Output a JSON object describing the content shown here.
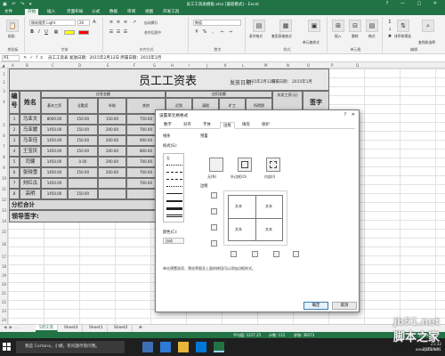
{
  "titlebar": {
    "qat": "▣ ↶ ↷ ▾",
    "title": "员工工资表模板.xlsx [兼容模式] - Excel",
    "window_buttons": "? — □ ✕"
  },
  "ribbon_tabs": [
    "文件",
    "开始",
    "插入",
    "页面布局",
    "公式",
    "数据",
    "审阅",
    "视图",
    "开发工具"
  ],
  "ribbon": {
    "paste": "粘贴",
    "clipboard": "剪贴板",
    "font_name": "微软雅黑 Light",
    "font_size": "26",
    "font": "字体",
    "alignment": "对齐方式",
    "wrap": "自动换行",
    "merge": "合并后居中",
    "number_format": "数值",
    "number": "数字",
    "conditional": "条件格式",
    "table_format": "套用表格格式",
    "cell_styles": "单元格样式",
    "styles": "样式",
    "insert": "插入",
    "delete": "删除",
    "format": "格式",
    "cells": "单元格",
    "sort_filter": "排序和筛选",
    "find_select": "查找和选择",
    "editing": "编辑"
  },
  "formula_bar": {
    "name_box": "A1",
    "content": "员工工资表   发放日期：2015年2月12日  所属日期：2015年1月"
  },
  "columns": [
    "A",
    "B",
    "C",
    "D",
    "E",
    "F",
    "G",
    "H",
    "I",
    "J",
    "K",
    "L",
    "M",
    "N",
    "O",
    "P",
    "Q"
  ],
  "rows": [
    "1",
    "2",
    "3",
    "4",
    "5",
    "6",
    "7",
    "8",
    "9",
    "10",
    "11",
    "12",
    "13",
    "14",
    "15",
    "16",
    "17",
    "18",
    "19",
    "20",
    "21",
    "22",
    "23",
    "24",
    "25",
    "26",
    "27",
    "28"
  ],
  "sheet": {
    "title": "员工工资表",
    "issue_date": "发放日期：",
    "issue_date_value": "2015年2月12日",
    "period_label": "所属日期：",
    "period_value": "2015年1月",
    "col_no": "编号",
    "col_name": "姓名",
    "payable": "应发金额",
    "deduct": "应扣金额",
    "basic": "基本工资",
    "allowance": "全勤奖",
    "subsidy": "补助",
    "other": "其他",
    "late": "迟到",
    "leave": "请假",
    "absent": "旷工",
    "tax": "所得税",
    "actual": "实发工资(元)",
    "sign": "签字",
    "rows": [
      {
        "no": "1",
        "name": "马亚文",
        "basic": "8000.00",
        "allow": "150.00",
        "sub": "150.00",
        "other": "750.00"
      },
      {
        "no": "2",
        "name": "马亚媛",
        "basic": "1450.00",
        "allow": "150.00",
        "sub": "200.00",
        "other": "700.00"
      },
      {
        "no": "3",
        "name": "马亚佳",
        "basic": "1450.00",
        "allow": "150.00",
        "sub": "200.00",
        "other": "900.00"
      },
      {
        "no": "4",
        "name": "王宝庆",
        "basic": "1450.00",
        "allow": "150.00",
        "sub": "200.00",
        "other": "800.00"
      },
      {
        "no": "5",
        "name": "司健",
        "basic": "1450.00",
        "allow": "0.00",
        "sub": "200.00",
        "other": "700.00"
      },
      {
        "no": "6",
        "name": "张晓雪",
        "basic": "1450.00",
        "allow": "150.00",
        "sub": "200.00",
        "other": "700.00"
      },
      {
        "no": "7",
        "name": "刘红瓜",
        "basic": "1450.00",
        "allow": "",
        "sub": "",
        "other": "700.00"
      },
      {
        "no": "8",
        "name": "高明",
        "basic": "1450.00",
        "allow": "150.00",
        "sub": "",
        "other": ""
      }
    ],
    "subtotal": "分栏合计",
    "leader_sign": "领导签字:"
  },
  "sheet_tabs": [
    "5月工资",
    "Sheet3",
    "Sheet1",
    "Sheet2"
  ],
  "status": {
    "average": "平均值: 1227.25",
    "count": "计数: 112",
    "sum": "求和: 39273",
    "zoom": "100%"
  },
  "taskbar": {
    "search": "我是 Cortana，小娜。有问题尽管问我。",
    "time": "21:32",
    "date": "2015/9/11"
  },
  "dialog": {
    "title": "设置单元格格式",
    "help": "?",
    "close": "✕",
    "tabs": [
      "数字",
      "对齐",
      "字体",
      "边框",
      "填充",
      "保护"
    ],
    "active_tab": "边框",
    "line_group": "线条",
    "style_label": "样式(S):",
    "none_style": "无",
    "color_label": "颜色(C):",
    "color_value": "自动",
    "presets_label": "预置",
    "preset_none": "无(N)",
    "preset_outline": "外边框(O)",
    "preset_inside": "内部(I)",
    "border_label": "边框",
    "preview_text": "文本",
    "hint": "单击预置选项、预览草图及上面的按钮可以添加边框样式。",
    "ok": "确定",
    "cancel": "取消"
  },
  "watermark": {
    "site": "jb51.net",
    "brand": "脚本之家",
    "url": "www.jb51.net"
  },
  "colors": {
    "excel_green": "#217346",
    "taskbar": "#1f1f1f"
  }
}
